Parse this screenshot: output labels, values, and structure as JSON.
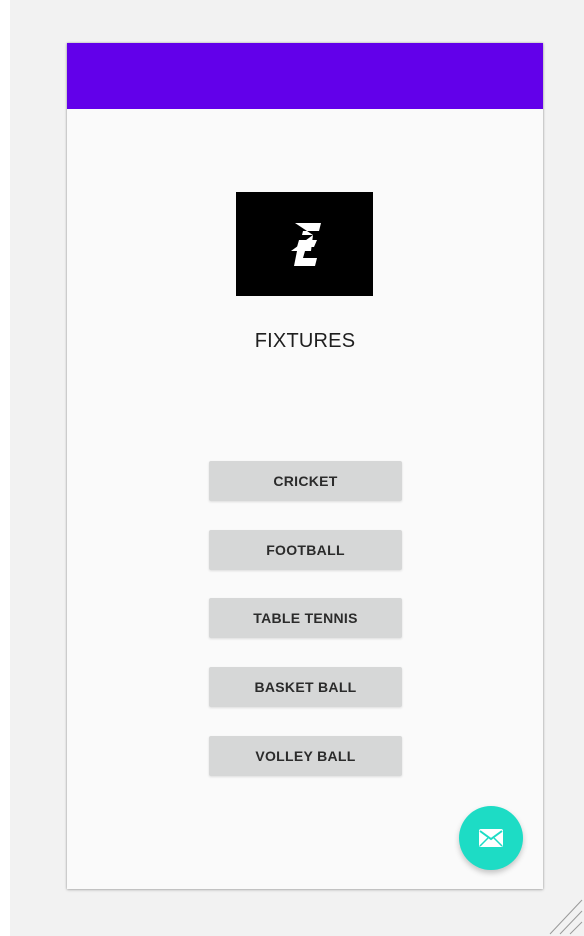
{
  "app": {
    "app_bar_color": "#6200ea",
    "logo_icon": "lightning-e-logo",
    "title": "FIXTURES"
  },
  "sports": [
    {
      "label": "CRICKET"
    },
    {
      "label": "FOOTBALL"
    },
    {
      "label": "TABLE TENNIS"
    },
    {
      "label": "BASKET BALL"
    },
    {
      "label": "VOLLEY BALL"
    }
  ],
  "fab": {
    "icon": "mail-icon",
    "color": "#1ddcc5"
  }
}
